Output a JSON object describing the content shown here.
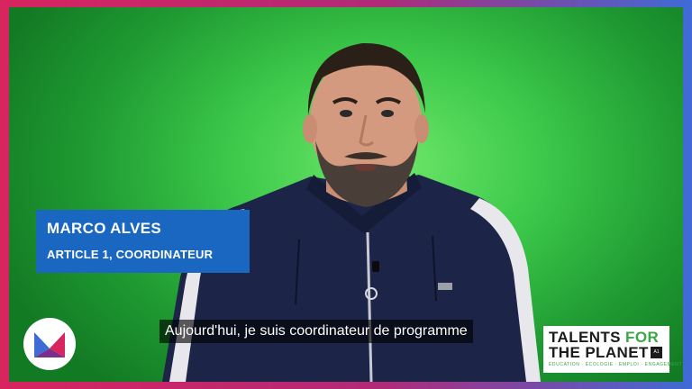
{
  "lower_third": {
    "name": "MARCO ALVES",
    "role": "ARTICLE 1, COORDINATEUR"
  },
  "subtitle": {
    "text": "Aujourd'hui, je suis coordinateur de programme"
  },
  "logo_right": {
    "line1": "TALENTS ",
    "line1_accent": "FOR",
    "line2": "THE PLANET",
    "tagline": "ÉDUCATION · ÉCOLOGIE · EMPLOI · ENGAGEMENT"
  },
  "colors": {
    "frame_pink": "#d8245f",
    "frame_blue": "#3f6bd6",
    "background_green": "#3cc84a",
    "lower_third_blue": "#1a67c2",
    "jacket_navy": "#1c2547"
  },
  "icons": {
    "channel_logo": "m-logo-icon"
  }
}
